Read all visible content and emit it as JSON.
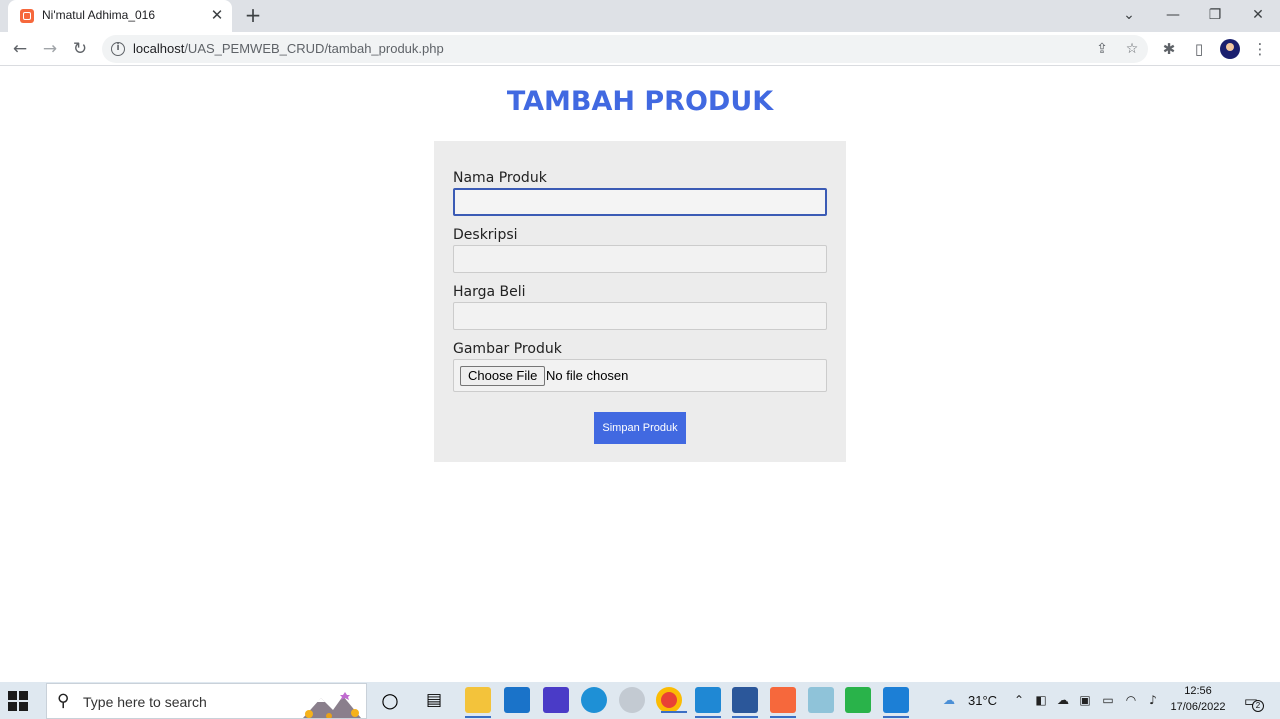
{
  "browser": {
    "tab_title": "Ni'matul Adhima_016",
    "tab_close": "✕",
    "new_tab": "+",
    "url_host": "localhost",
    "url_path": "/UAS_PEMWEB_CRUD/tambah_produk.php",
    "window_controls": [
      "⌄",
      "—",
      "❐",
      "✕"
    ],
    "icons": [
      "back-icon",
      "forward-icon",
      "reload-icon",
      "info-icon",
      "share-icon",
      "bookmark-star-icon",
      "extensions-icon",
      "side-panel-icon",
      "profile-avatar",
      "menu-kebab-icon"
    ]
  },
  "page": {
    "title": "TAMBAH PRODUK",
    "accent_color": "#4169e1",
    "form": {
      "nama_produk_label": "Nama Produk",
      "deskripsi_label": "Deskripsi",
      "harga_beli_label": "Harga Beli",
      "gambar_produk_label": "Gambar Produk",
      "file_button": "Choose File",
      "file_status": "No file chosen",
      "submit_label": "Simpan Produk"
    }
  },
  "taskbar": {
    "search_placeholder": "Type here to search",
    "temperature": "31°C",
    "time": "12:56",
    "date": "17/06/2022",
    "notification_count": "2",
    "apps": [
      "cortana-icon",
      "task-view-icon",
      "file-explorer-icon",
      "mail-icon",
      "app-icon",
      "edge-icon",
      "app-icon",
      "chrome-icon",
      "app-icon",
      "word-icon",
      "xampp-icon",
      "app-icon",
      "app-icon",
      "vscode-icon"
    ]
  }
}
